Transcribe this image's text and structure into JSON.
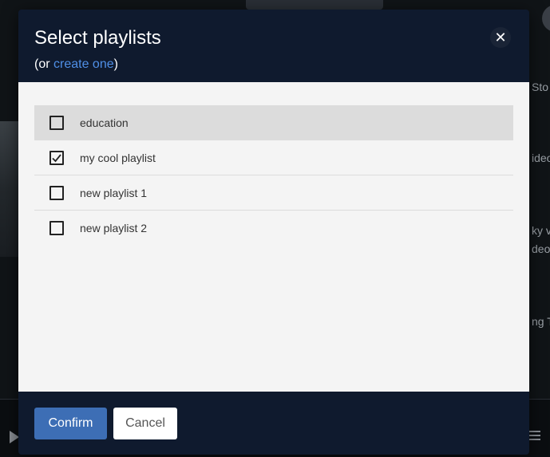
{
  "background": {
    "side_texts": [
      "Sto",
      "ideo",
      "ky v",
      "deo",
      "ng T"
    ]
  },
  "modal": {
    "title": "Select playlists",
    "subtitle_prefix": "(or ",
    "subtitle_link": "create one",
    "subtitle_suffix": ")",
    "close_label": "✕",
    "playlists": [
      {
        "label": "education",
        "checked": false,
        "hovered": true
      },
      {
        "label": "my cool playlist",
        "checked": true,
        "hovered": false
      },
      {
        "label": "new playlist 1",
        "checked": false,
        "hovered": false
      },
      {
        "label": "new playlist 2",
        "checked": false,
        "hovered": false
      }
    ],
    "confirm_label": "Confirm",
    "cancel_label": "Cancel"
  },
  "colors": {
    "header_bg": "#0f1a2e",
    "link": "#4f8fe6",
    "confirm_bg": "#3d6eb5",
    "body_bg": "#f4f4f4",
    "hover_row": "#dcdcdc"
  }
}
